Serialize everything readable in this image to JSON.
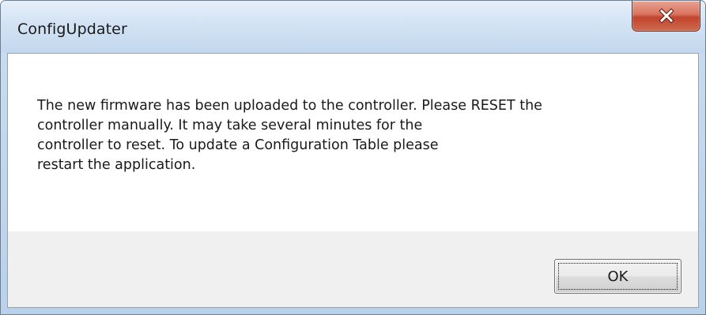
{
  "window": {
    "title": "ConfigUpdater"
  },
  "title_bar": {
    "close_icon": "close-x-icon",
    "close_color": "#c94a30"
  },
  "message": {
    "lines": [
      "The new firmware has been uploaded to the controller. Please RESET the",
      "controller manually. It may take several minutes for the",
      "controller to reset. To update a Configuration Table please",
      "restart the application."
    ]
  },
  "buttons": {
    "ok_label": "OK"
  }
}
